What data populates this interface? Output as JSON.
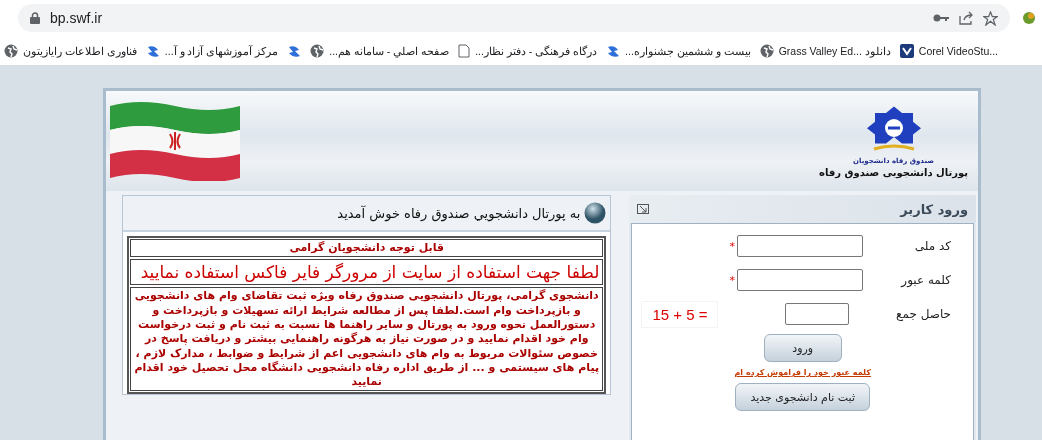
{
  "browser": {
    "url": "bp.swf.ir",
    "bookmarks": [
      {
        "label": "Corel VideoStu...",
        "kind": "app"
      },
      {
        "label": "دانلود ...Grass Valley Ed",
        "kind": "globe"
      },
      {
        "label": "بیست و ششمین جشنواره...",
        "kind": "logo"
      },
      {
        "label": "درگاه فرهنگی - دفتر نظار...",
        "kind": "page"
      },
      {
        "label": "صفحه اصلي - سامانه هم...",
        "kind": "globe"
      },
      {
        "kind": "logo"
      },
      {
        "label": "مرکز آموزشهای آزاد و آ...",
        "kind": "logo"
      },
      {
        "label": "فناوری اطلاعات رایازیتون",
        "kind": "globe"
      }
    ]
  },
  "header": {
    "logo_caption": "صندوق رفاه دانشجویان",
    "portal_title": "پورتال دانشجویی صندوق رفاه"
  },
  "welcome": {
    "title": "به پورتال دانشجويي صندوق رفاه خوش آمديد",
    "notice_heading": "قابل توجه دانشجويان گرامی",
    "browser_notice": "لطفا جهت استفاده از سایت از مرورگر فایر فاکس استفاده نمایید",
    "message": "دانشجوی گرامی، پورتال دانشجویی صندوق رفاه ویژه ثبت تقاضای وام های دانشجویی و بازپرداخت وام است.لطفا پس از مطالعه شرایط ارائه تسهیلات و بازپرداخت و دستورالعمل نحوه ورود به پورتال و سایر راهنما ها نسبت به ثبت نام و ثبت درخواست وام خود اقدام نمایید و در صورت نیاز به هرگونه راهنمایی بیشتر و دریافت پاسخ در خصوص سئوالات مربوط به وام های دانشجویی اعم از شرایط و ضوابط ، مدارک لازم ، پیام های سیستمی و ... از طریق اداره رفاه دانشجویی دانشگاه محل تحصیل خود اقدام نمایید"
  },
  "login": {
    "title": "ورود کاربر",
    "fields": [
      {
        "label": "کد ملی",
        "required": true,
        "kind": "text"
      },
      {
        "label": "کلمه عبور",
        "required": true,
        "kind": "password"
      },
      {
        "label": "حاصل جمع",
        "required": false,
        "kind": "captcha",
        "captcha": "15 + 5 ="
      }
    ],
    "required_mark": "*",
    "submit": "ورود",
    "forgot_link": "کلمه عبور خود را فراموش کرده ام",
    "register": "ثبت نام دانشجوی جدید"
  }
}
